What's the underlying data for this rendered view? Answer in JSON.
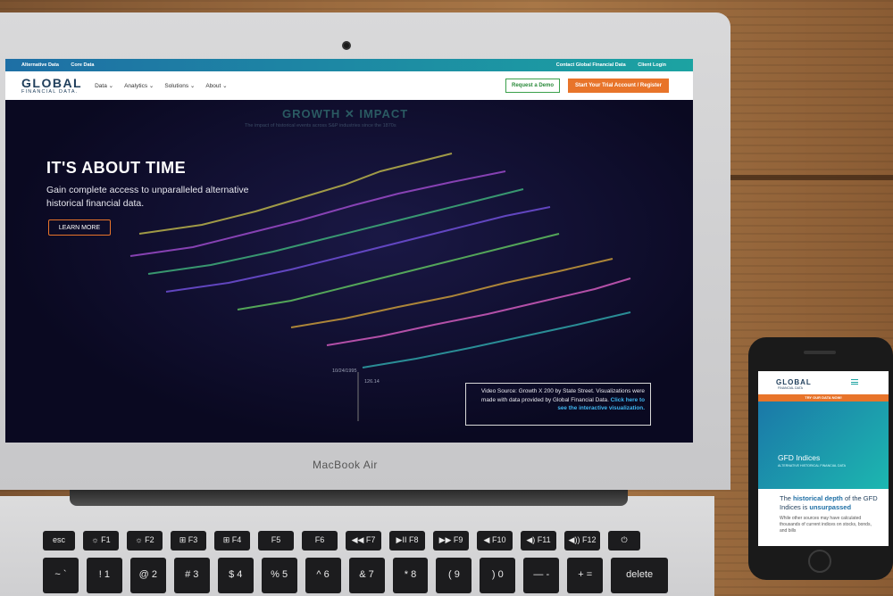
{
  "topbar": {
    "left_links": [
      "Alternative Data",
      "Core Data"
    ],
    "right_links": [
      "Contact Global Financial Data",
      "Client Login"
    ]
  },
  "logo": {
    "main": "GLOBAL",
    "sub": "FINANCIAL DATA."
  },
  "nav": {
    "items": [
      "Data ⌄",
      "Analytics ⌄",
      "Solutions ⌄",
      "About ⌄"
    ]
  },
  "buttons": {
    "demo": "Request a Demo",
    "trial": "Start Your Trial Account / Register",
    "learn": "LEARN MORE"
  },
  "hero": {
    "title": "IT'S ABOUT TIME",
    "subtitle": "Gain complete access to unparalleled alternative historical financial data.",
    "chart_title": "GROWTH ✕ IMPACT",
    "chart_sub": "The impact of historical events across S&P industries since the 1870s",
    "date": "10/24/1995",
    "value": "126.14"
  },
  "video_source": {
    "text": "Video Source: Growth X 200 by State Street. Visualizations were made with data provided by Global Financial Data.",
    "link": "Click here to see the interactive visualization."
  },
  "laptop": {
    "brand": "MacBook Air"
  },
  "keyboard": {
    "row1": [
      "esc",
      "☼ F1",
      "☼ F2",
      "⊞ F3",
      "⊞ F4",
      "F5",
      "F6",
      "◀◀ F7",
      "▶II F8",
      "▶▶ F9",
      "◀ F10",
      "◀) F11",
      "◀)) F12",
      "⏻"
    ],
    "row2": [
      "~ `",
      "! 1",
      "@ 2",
      "# 3",
      "$ 4",
      "% 5",
      "^ 6",
      "& 7",
      "* 8",
      "( 9",
      ") 0",
      "— -",
      "+ =",
      "delete"
    ]
  },
  "phone": {
    "logo": "GLOBAL",
    "logo_sub": "FINANCIAL DATA",
    "cta": "TRY OUR DATA NOW!",
    "title": "GFD Indices",
    "subtitle": "ALTERNATIVE HISTORICAL FINANCIAL DATA",
    "heading_pre": "The ",
    "heading_b1": "historical depth",
    "heading_mid": " of the GFD Indices is ",
    "heading_b2": "unsurpassed",
    "body": "While other sources may have calculated thousands of current indices on stocks, bonds, and bills"
  },
  "colors": {
    "teal": "#1ca3a2",
    "orange": "#e8742a",
    "navy": "#1f3e5b"
  }
}
